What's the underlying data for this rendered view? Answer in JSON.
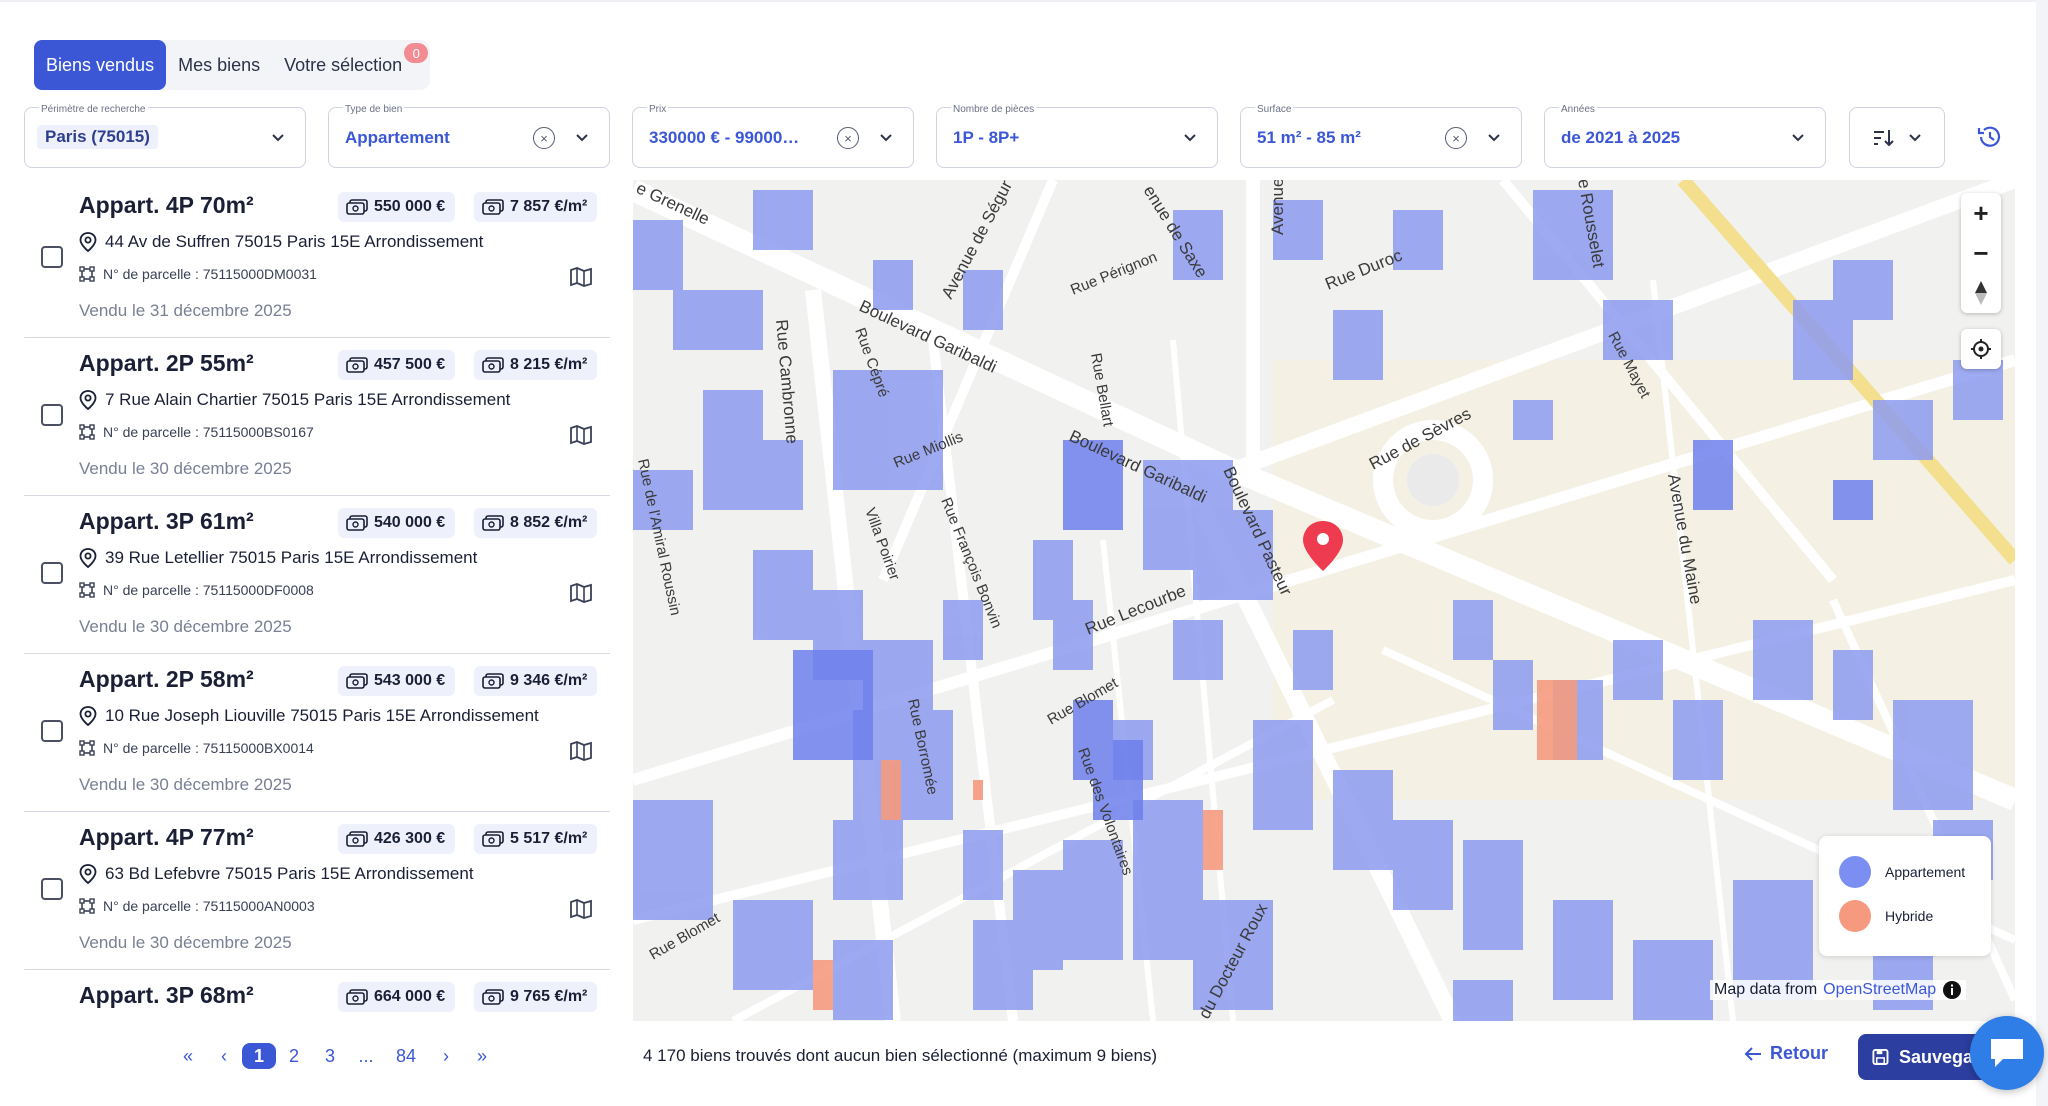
{
  "tabs": [
    {
      "label": "Biens vendus",
      "active": true
    },
    {
      "label": "Mes biens",
      "active": false
    },
    {
      "label": "Votre sélection",
      "active": false,
      "badge": "0"
    }
  ],
  "filters": {
    "perimetre": {
      "label": "Périmètre de recherche",
      "value": "Paris (75015)"
    },
    "type": {
      "label": "Type de bien",
      "value": "Appartement"
    },
    "prix": {
      "label": "Prix",
      "value": "330000 €  -  99000…"
    },
    "pieces": {
      "label": "Nombre de pièces",
      "value": "1P - 8P+"
    },
    "surface": {
      "label": "Surface",
      "value": "51 m²  -  85 m²"
    },
    "annees": {
      "label": "Années",
      "value": "de 2021 à 2025"
    }
  },
  "listings": [
    {
      "title": "Appart. 4P 70m²",
      "price": "550 000 €",
      "ppm": "7 857 €/m²",
      "address": "44 Av de Suffren 75015 Paris 15E Arrondissement",
      "parcel": "N° de parcelle : 75115000DM0031",
      "sold": "Vendu le 31 décembre 2025"
    },
    {
      "title": "Appart. 2P 55m²",
      "price": "457 500 €",
      "ppm": "8 215 €/m²",
      "address": "7 Rue Alain Chartier 75015 Paris 15E Arrondissement",
      "parcel": "N° de parcelle : 75115000BS0167",
      "sold": "Vendu le 30 décembre 2025"
    },
    {
      "title": "Appart. 3P 61m²",
      "price": "540 000 €",
      "ppm": "8 852 €/m²",
      "address": "39 Rue Letellier 75015 Paris 15E Arrondissement",
      "parcel": "N° de parcelle : 75115000DF0008",
      "sold": "Vendu le 30 décembre 2025"
    },
    {
      "title": "Appart. 2P 58m²",
      "price": "543 000 €",
      "ppm": "9 346 €/m²",
      "address": "10 Rue Joseph Liouville 75015 Paris 15E Arrondissement",
      "parcel": "N° de parcelle : 75115000BX0014",
      "sold": "Vendu le 30 décembre 2025"
    },
    {
      "title": "Appart. 4P 77m²",
      "price": "426 300 €",
      "ppm": "5 517 €/m²",
      "address": "63 Bd Lefebvre 75015 Paris 15E Arrondissement",
      "parcel": "N° de parcelle : 75115000AN0003",
      "sold": "Vendu le 30 décembre 2025"
    },
    {
      "title": "Appart. 3P 68m²",
      "price": "664 000 €",
      "ppm": "9 765 €/m²",
      "address": "",
      "parcel": "",
      "sold": ""
    }
  ],
  "pagination": {
    "first": "«",
    "prev": "‹",
    "pages": [
      "1",
      "2",
      "3"
    ],
    "ellipsis": "...",
    "last_page": "84",
    "next": "›",
    "last": "»",
    "current": "1"
  },
  "map": {
    "streets": {
      "s1": "e Grenelle",
      "s2": "Boulevard Garibaldi",
      "s3": "Avenue de Ségur",
      "s4": "enue de Saxe",
      "s5": "Avenue",
      "s6": "Rue Duroc",
      "s7": "e Rousselet",
      "s8": "Rue Pérignon",
      "s9": "Rue Cambronne",
      "s10": "Rue Cépré",
      "s11": "Rue Miollis",
      "s12": "Rue Bellart",
      "s13": "Boulevard Garibaldi",
      "s14": "Rue de Sèvres",
      "s15": "Rue Mayet",
      "s16": "Rue François Bonvin",
      "s17": "Rue Lecourbe",
      "s18": "Boulevard Pasteur",
      "s19": "Avenue du Maine",
      "s20": "Rue de l'Amiral Roussin",
      "s21": "Villa Poirier",
      "s22": "Rue Blomet",
      "s23": "Rue Borromée",
      "s24": "Rue Blomet",
      "s25": "Rue des Volontaires",
      "s26": "du Docteur Roux"
    },
    "legend": [
      {
        "label": "Appartement",
        "color": "#7b8ff2"
      },
      {
        "label": "Hybride",
        "color": "#f59a7e"
      }
    ],
    "attribution_text": "Map data from",
    "attribution_link": "OpenStreetMap",
    "zoom_in": "+",
    "zoom_out": "−",
    "building_color": "#8d9cf0",
    "pin_color": "#ef3b4f"
  },
  "footer": {
    "status": "4 170 biens trouvés dont aucun bien sélectionné (maximum 9 biens)",
    "back": "Retour",
    "save": "Sauvegarder"
  }
}
